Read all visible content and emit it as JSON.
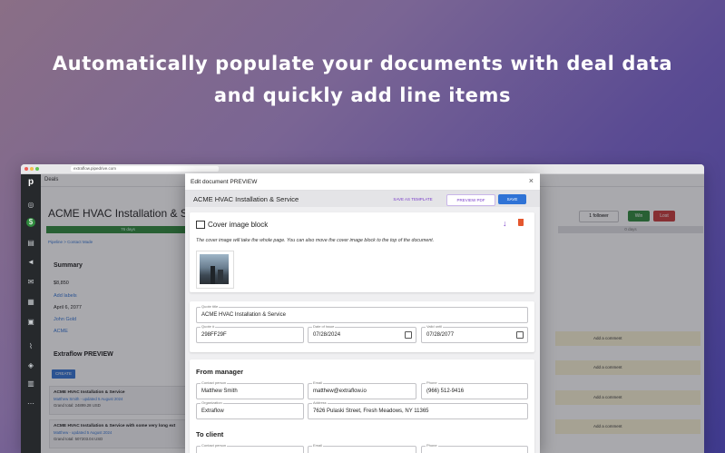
{
  "hero": {
    "line1": "Automatically populate your documents with deal data",
    "line2": "and quickly add line items"
  },
  "browser": {
    "url": "extraflow.pipedrive.com"
  },
  "app": {
    "breadcrumb_top": "Deals",
    "deal_title": "ACME HVAC Installation & Service",
    "stage_label": "76 days",
    "stage_label_right": "0 days",
    "crumb": "Pipeline  >  Contact Made",
    "summary_title": "Summary",
    "summary": {
      "value": "$8,850",
      "add_labels": "Add labels",
      "date": "April 6, 2077",
      "person": "John Gold",
      "org": "ACME"
    },
    "extraflow_title": "Extraflow PREVIEW",
    "create_label": "CREATE",
    "cards": [
      {
        "title": "ACME HVAC Installation & Service",
        "sub": "Matthew Smith - updated 5 August 2024",
        "total": "Grand total: 24899.28 USD"
      },
      {
        "title": "ACME HVAC Installation & Service with some very long ext",
        "sub": "Matthew - updated 5 August 2024",
        "total": "Grand total: 507203.04 USD"
      }
    ],
    "follower_label": "1 follower",
    "win_label": "Win",
    "lost_label": "Lost",
    "add_comment": "Add a comment"
  },
  "modal": {
    "title": "Edit document PREVIEW",
    "doc_title": "ACME HVAC Installation & Service",
    "save_template_label": "SAVE AS TEMPLATE",
    "preview_pdf_label": "PREVIEW PDF",
    "save_label": "SAVE",
    "cover": {
      "title": "Cover image block",
      "description": "The cover image will take the whole page. You can also move the cover image block to the top of the document."
    },
    "quote": {
      "title_label": "Quote title",
      "title_value": "ACME HVAC Installation & Service",
      "number_label": "Quote #",
      "number_value": "298FF29F",
      "issue_label": "Date of issue",
      "issue_value": "07/28/2024",
      "valid_label": "Valid until",
      "valid_value": "07/28/2077"
    },
    "from_manager": {
      "heading": "From manager",
      "contact_label": "Contact person",
      "contact_value": "Matthew Smith",
      "email_label": "Email",
      "email_value": "matthew@extraflow.io",
      "phone_label": "Phone",
      "phone_value": "(966) 512-9416",
      "org_label": "Organization",
      "org_value": "Extraflow",
      "address_label": "Address",
      "address_value": "7626 Pulaski Street, Fresh Meadows, NY 11365"
    },
    "to_client": {
      "heading": "To client",
      "contact_label": "Contact person",
      "email_label": "Email",
      "phone_label": "Phone"
    }
  }
}
